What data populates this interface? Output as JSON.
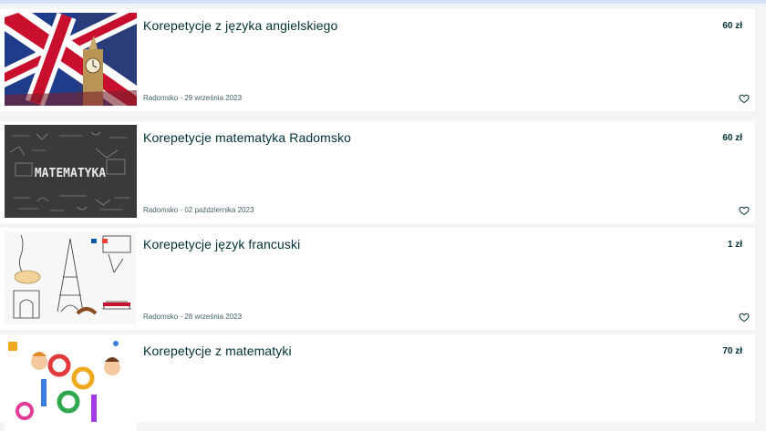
{
  "listings": [
    {
      "title": "Korepetycje z języka angielskiego",
      "price": "60 zł",
      "location_date": "Radomsko - 29 września 2023",
      "image": "uk-flag-big-ben-photo",
      "favorite_icon": "heart-outline-icon"
    },
    {
      "title": "Korepetycje matematyka Radomsko",
      "price": "60 zł",
      "location_date": "Radomsko - 02 października 2023",
      "image": "chalkboard-matematyka-photo",
      "image_text": "MATEMATYKA",
      "favorite_icon": "heart-outline-icon"
    },
    {
      "title": "Korepetycje język francuski",
      "price": "1 zł",
      "location_date": "Radomsko - 28 września 2023",
      "image": "french-sketches-eiffel-tower",
      "favorite_icon": "heart-outline-icon"
    },
    {
      "title": "Korepetycje z matematyki",
      "price": "70 zł",
      "image": "kids-with-numbers-cartoon"
    }
  ],
  "colors": {
    "page_bg": "#f2f4f5",
    "card_bg": "#ffffff",
    "text": "#002f34",
    "meta_text": "#406367",
    "top_bar": "#d6e2f6"
  }
}
